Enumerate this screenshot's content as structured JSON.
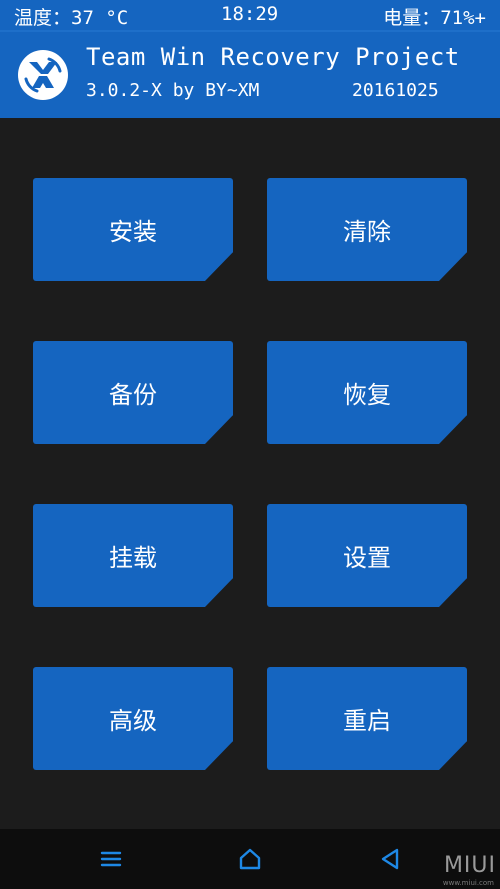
{
  "status_bar": {
    "temperature": "温度：37 °C",
    "time": "18:29",
    "battery": "电量：71%+"
  },
  "header": {
    "title": "Team Win Recovery Project",
    "version": "3.0.2-X by BY~XM",
    "date": "20161025"
  },
  "menu": [
    {
      "label": "安装"
    },
    {
      "label": "清除"
    },
    {
      "label": "备份"
    },
    {
      "label": "恢复"
    },
    {
      "label": "挂载"
    },
    {
      "label": "设置"
    },
    {
      "label": "高级"
    },
    {
      "label": "重启"
    }
  ],
  "nav_bar": {
    "icons": [
      "menu-icon",
      "home-icon",
      "back-icon"
    ],
    "watermark": "MIUI",
    "watermark_sub": "www.miui.com"
  },
  "colors": {
    "accent": "#1565c0",
    "background": "#1c1c1c",
    "nav_background": "#0d0d0d",
    "nav_icon": "#1e88e5"
  }
}
